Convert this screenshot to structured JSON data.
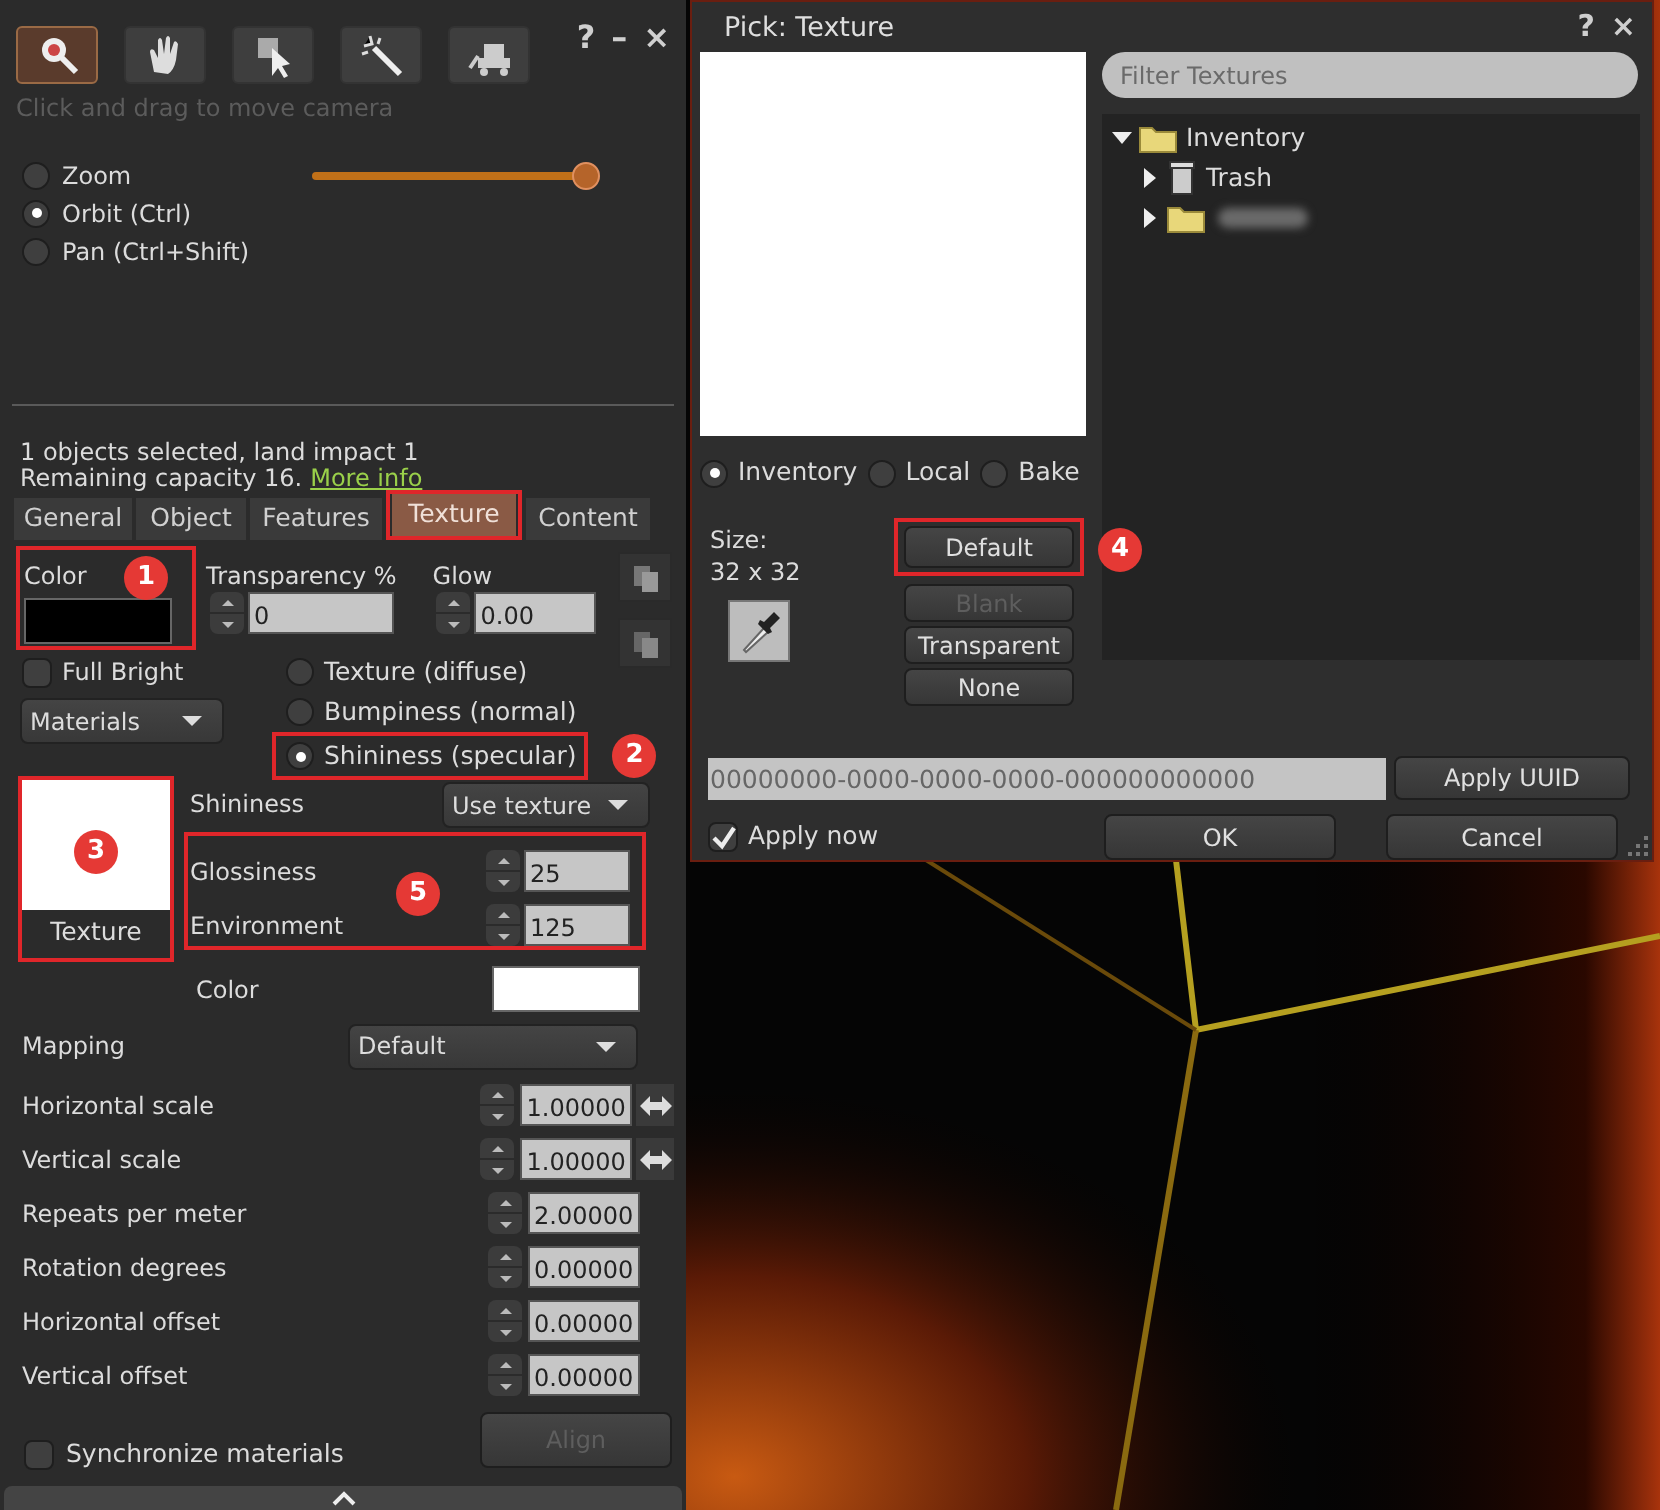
{
  "tools_window": {
    "tool_buttons": [
      {
        "kind": "camera",
        "selected": true
      },
      {
        "kind": "grab",
        "selected": false
      },
      {
        "kind": "select",
        "selected": false
      },
      {
        "kind": "create",
        "selected": false
      },
      {
        "kind": "land",
        "selected": false
      }
    ],
    "window_controls": [
      "?",
      "–",
      "×"
    ],
    "hint": "Click and drag to move camera",
    "camera_modes": [
      {
        "label": "Zoom",
        "selected": false
      },
      {
        "label": "Orbit (Ctrl)",
        "selected": true
      },
      {
        "label": "Pan (Ctrl+Shift)",
        "selected": false
      }
    ],
    "zoom_slider": {
      "level": 1
    },
    "selection_info": "1 objects selected, land impact 1",
    "capacity": "Remaining capacity 16.",
    "more_info_link": "More info",
    "tabs": [
      {
        "label": "General",
        "selected": false,
        "outlined": false
      },
      {
        "label": "Object",
        "selected": false,
        "outlined": false
      },
      {
        "label": "Features",
        "selected": false,
        "outlined": false
      },
      {
        "label": "Texture",
        "selected": true,
        "outlined": true
      },
      {
        "label": "Content",
        "selected": false,
        "outlined": false
      }
    ],
    "texture_tab": {
      "color_field": {
        "label": "Color",
        "color": "#000000",
        "annotation": "1"
      },
      "transparency": {
        "label": "Transparency %",
        "value": "0"
      },
      "glow": {
        "label": "Glow",
        "value": "0.00"
      },
      "full_bright": {
        "label": "Full Bright",
        "checked": false
      },
      "materials_dropdown": "Materials",
      "material_types": [
        {
          "label": "Texture (diffuse)",
          "selected": false
        },
        {
          "label": "Bumpiness (normal)",
          "selected": false
        },
        {
          "label": "Shininess (specular)",
          "selected": true,
          "annotation": "2"
        }
      ],
      "texture_swatch": {
        "label": "Texture",
        "annotation": "3"
      },
      "shininess": {
        "label": "Shininess",
        "value": "Use texture"
      },
      "specular_group": {
        "annotation": "5",
        "fields": [
          {
            "label": "Glossiness",
            "value": "25"
          },
          {
            "label": "Environment",
            "value": "125"
          }
        ]
      },
      "specular_color": {
        "label": "Color",
        "color": "#ffffff"
      },
      "mapping": {
        "label": "Mapping",
        "value": "Default"
      },
      "values": [
        {
          "label": "Horizontal scale",
          "value": "1.00000",
          "flip": true
        },
        {
          "label": "Vertical scale",
          "value": "1.00000",
          "flip": true
        },
        {
          "label": "Repeats per meter",
          "value": "2.00000",
          "flip": false
        },
        {
          "label": "Rotation degrees",
          "value": "0.00000",
          "flip": false
        },
        {
          "label": "Horizontal offset",
          "value": "0.00000",
          "flip": false
        },
        {
          "label": "Vertical offset",
          "value": "0.00000",
          "flip": false
        }
      ],
      "synchronize_materials": {
        "label": "Synchronize materials",
        "checked": false
      },
      "align_button": {
        "label": "Align",
        "disabled": true
      }
    }
  },
  "picker": {
    "title": "Pick: Texture",
    "window_controls": [
      "?",
      "×"
    ],
    "filter": {
      "placeholder": "Filter Textures"
    },
    "tree": [
      {
        "label": "Inventory",
        "kind": "folder",
        "expanded": true,
        "children": [
          {
            "label": "Trash",
            "kind": "trash",
            "expanded": false
          },
          {
            "kind": "folder",
            "expanded": false
          }
        ]
      }
    ],
    "sources": [
      {
        "label": "Inventory",
        "selected": true
      },
      {
        "label": "Local",
        "selected": false
      },
      {
        "label": "Bake",
        "selected": false
      }
    ],
    "size_label": "Size:",
    "size_value": "32 x 32",
    "buttons": [
      {
        "label": "Default",
        "disabled": false,
        "annotation": "4"
      },
      {
        "label": "Blank",
        "disabled": true
      },
      {
        "label": "Transparent",
        "disabled": false
      },
      {
        "label": "None",
        "disabled": false
      }
    ],
    "uuid": "00000000-0000-0000-0000-000000000000",
    "apply_uuid": "Apply UUID",
    "apply_now": {
      "label": "Apply now",
      "checked": true
    },
    "ok": "OK",
    "cancel": "Cancel"
  }
}
